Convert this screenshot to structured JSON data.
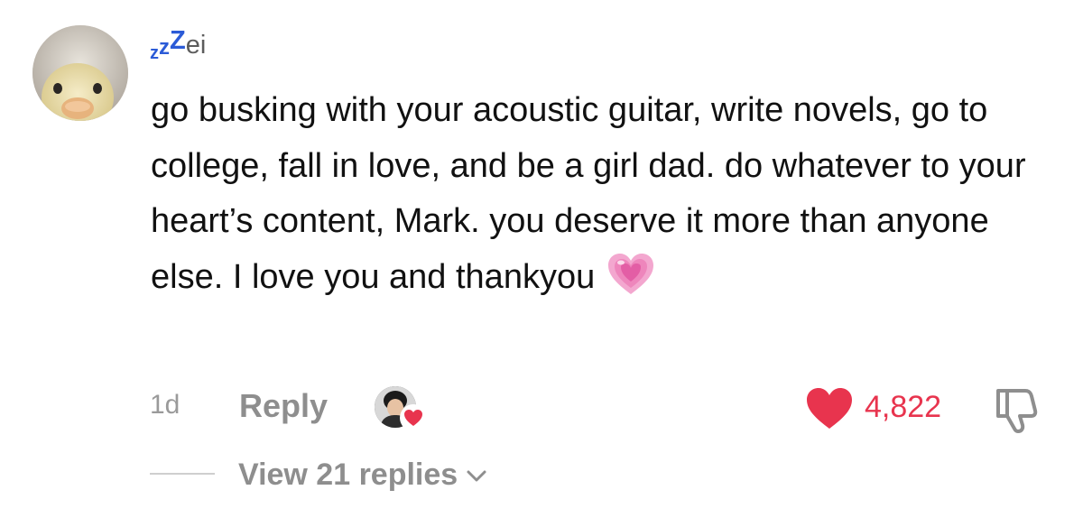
{
  "comment": {
    "username_suffix": "ei",
    "username_zzz": [
      "z",
      "z",
      "Z"
    ],
    "text": "go busking with your acoustic guitar, write novels, go to college, fall in love, and be a girl dad. do whatever to your heart’s content, Mark. you deserve it more than anyone else. I love you and thankyou",
    "emoji": "growing-heart-emoji",
    "time_ago": "1d",
    "reply_label": "Reply",
    "like_count": "4,822",
    "view_replies_label": "View 21 replies"
  },
  "colors": {
    "like": "#e8344e",
    "username_zzz": "#2b5bd7",
    "secondary_text": "#8e8e8e"
  },
  "icons": {
    "avatar": "duckling-avatar",
    "creator_avatar": "creator-avatar-with-heart",
    "like": "heart-icon",
    "dislike": "thumbs-down-icon",
    "expand": "chevron-down-icon"
  }
}
